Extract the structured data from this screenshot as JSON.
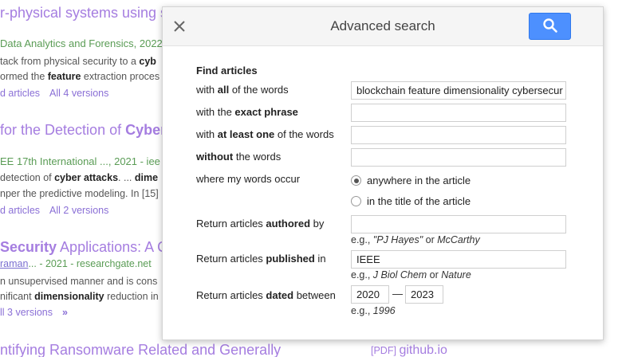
{
  "background": {
    "r1_title": "r-physical systems using su",
    "r1_source": "Data Analytics and Forensics, 2022",
    "r1_snip1_a": "tack from physical security to a ",
    "r1_snip1_b": "cyb",
    "r1_snip2_a": "ormed the ",
    "r1_snip2_b": "feature",
    "r1_snip2_c": " extraction proces",
    "r1_links": [
      "d articles",
      "All 4 versions"
    ],
    "r2_title_a": "for the Detection of ",
    "r2_title_b": "Cyber A",
    "r2_source": "EE 17th International ..., 2021 - iee",
    "r2_snip1_a": "detection of ",
    "r2_snip1_b": "cyber attacks",
    "r2_snip1_c": ". ... ",
    "r2_snip1_d": "dime",
    "r2_snip2": "nper the predictive modeling. In [15]",
    "r2_links": [
      "d articles",
      "All 2 versions"
    ],
    "r3_title_a": "Security",
    "r3_title_b": " Applications: A Co",
    "r3_author_a": "raman",
    "r3_author_b": "... - 2021 - researchgate.net",
    "r3_snip1": "n unsupervised manner and is cons",
    "r3_snip2_a": "nificant ",
    "r3_snip2_b": "dimensionality",
    "r3_snip2_c": " reduction in",
    "r3_links": [
      "ll 3 versions",
      "»"
    ],
    "r4_title": "ntifying Ransomware Related and Generally",
    "r4_pdf_tag": "[PDF]",
    "r4_pdf_domain": "github.io"
  },
  "dialog": {
    "title": "Advanced search",
    "find_articles": "Find articles",
    "all_words": {
      "pre": "with ",
      "bold": "all",
      "post": " of the words",
      "value": "blockchain feature dimensionality cybersecur"
    },
    "exact_phrase": {
      "pre": "with the ",
      "bold": "exact phrase",
      "post": "",
      "value": ""
    },
    "at_least_one": {
      "pre": "with ",
      "bold": "at least one",
      "post": " of the words",
      "value": ""
    },
    "without": {
      "pre": "",
      "bold": "without",
      "post": " the words",
      "value": ""
    },
    "occur": {
      "label": "where my words occur",
      "options": [
        "anywhere in the article",
        "in the title of the article"
      ],
      "selected": 0
    },
    "authored": {
      "pre": "Return articles ",
      "bold": "authored",
      "post": " by",
      "value": "",
      "hint_pre": "e.g., ",
      "hint_i1": "\"PJ Hayes\"",
      "hint_mid": " or ",
      "hint_i2": "McCarthy"
    },
    "published": {
      "pre": "Return articles ",
      "bold": "published",
      "post": " in",
      "value": "IEEE",
      "hint_pre": "e.g., ",
      "hint_i1": "J Biol Chem",
      "hint_mid": " or ",
      "hint_i2": "Nature"
    },
    "dated": {
      "pre": "Return articles ",
      "bold": "dated",
      "post": " between",
      "from": "2020",
      "dash": "—",
      "to": "2023",
      "hint_pre": "e.g., ",
      "hint_i1": "1996"
    }
  },
  "colors": {
    "accent": "#4d90fe",
    "title_purple": "#a57de0",
    "source_green": "#5a9c55"
  },
  "icons": {
    "close": "close-icon",
    "search": "search-icon",
    "double_chevron": "double-chevron-icon"
  }
}
